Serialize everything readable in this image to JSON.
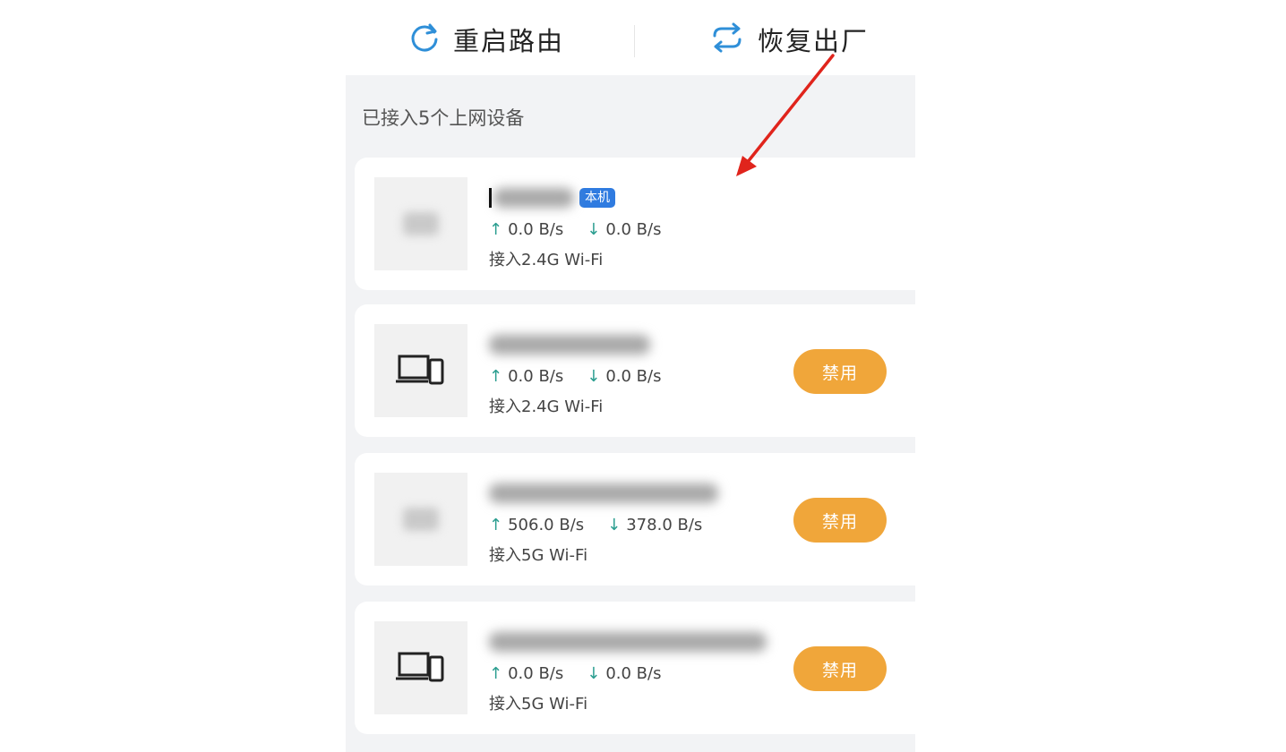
{
  "toolbar": {
    "restart_label": "重启路由",
    "reset_label": "恢复出厂"
  },
  "devices_section": {
    "title": "已接入5个上网设备"
  },
  "devices": [
    {
      "badge": "本机",
      "up": "0.0 B/s",
      "down": "0.0 B/s",
      "connection": "接入2.4G Wi-Fi",
      "icon": "blurred-device-icon"
    },
    {
      "up": "0.0 B/s",
      "down": "0.0 B/s",
      "connection": "接入2.4G Wi-Fi",
      "icon": "laptop-phone-icon",
      "action_label": "禁用"
    },
    {
      "up": "506.0 B/s",
      "down": "378.0 B/s",
      "connection": "接入5G Wi-Fi",
      "icon": "blurred-device-icon",
      "action_label": "禁用"
    },
    {
      "up": "0.0 B/s",
      "down": "0.0 B/s",
      "connection": "接入5G Wi-Fi",
      "icon": "laptop-phone-icon",
      "action_label": "禁用"
    }
  ],
  "colors": {
    "accent_blue": "#2f7be0",
    "disable_orange": "#f0a63a",
    "speed_arrow": "#2a9d8f",
    "annotation_red": "#e0241c"
  }
}
